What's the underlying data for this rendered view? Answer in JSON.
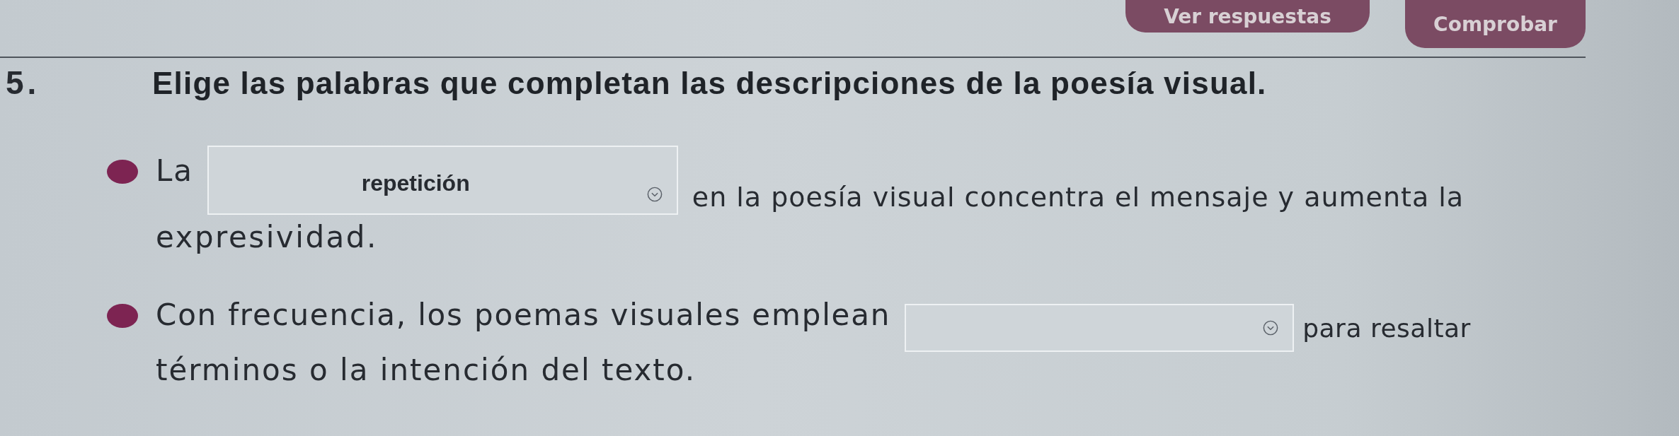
{
  "header": {
    "buttons": [
      {
        "label": "Ver respuestas"
      },
      {
        "label": "Comprobar"
      }
    ]
  },
  "question": {
    "number": "5.",
    "prompt": "Elige las palabras que completan las descripciones de la poesía visual.",
    "items": [
      {
        "text_before": "La",
        "answer": "repetición",
        "text_after": "en la poesía visual concentra el mensaje y aumenta la",
        "continuation": "expresividad."
      },
      {
        "text_before": "Con frecuencia, los poemas visuales emplean",
        "text_after": "para resaltar",
        "continuation": "términos o la intención del texto."
      }
    ]
  }
}
